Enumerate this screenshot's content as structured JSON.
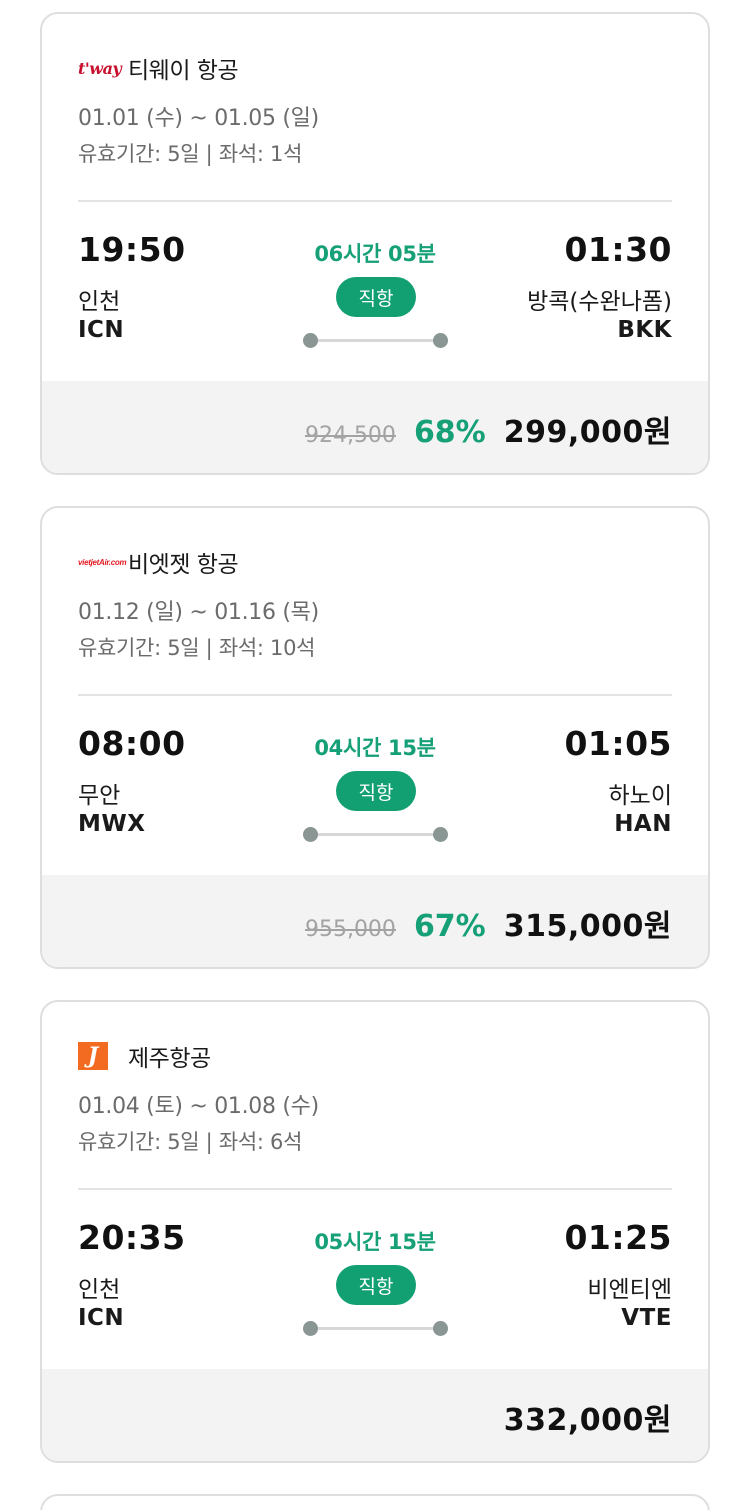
{
  "flights": [
    {
      "airline": "티웨이 항공",
      "logo_text": "t'way",
      "logo_icon": "tway-logo-icon",
      "dates": "01.01 (수) ~ 01.05 (일)",
      "meta": "유효기간: 5일 | 좌석: 1석",
      "departure": {
        "time": "19:50",
        "city": "인천",
        "code": "ICN"
      },
      "arrival": {
        "time": "01:30",
        "city": "방콕(수완나폼)",
        "code": "BKK"
      },
      "duration": "06시간 05분",
      "type_badge": "직항",
      "original_price": "924,500",
      "discount": "68%",
      "final_price": "299,000원"
    },
    {
      "airline": "비엣젯 항공",
      "logo_text": "vietjetAir.com",
      "logo_icon": "vietjet-logo-icon",
      "dates": "01.12 (일) ~ 01.16 (목)",
      "meta": "유효기간: 5일 | 좌석: 10석",
      "departure": {
        "time": "08:00",
        "city": "무안",
        "code": "MWX"
      },
      "arrival": {
        "time": "01:05",
        "city": "하노이",
        "code": "HAN"
      },
      "duration": "04시간 15분",
      "type_badge": "직항",
      "original_price": "955,000",
      "discount": "67%",
      "final_price": "315,000원"
    },
    {
      "airline": "제주항공",
      "logo_text": "J",
      "logo_icon": "jejuair-logo-icon",
      "dates": "01.04 (토) ~ 01.08 (수)",
      "meta": "유효기간: 5일 | 좌석: 6석",
      "departure": {
        "time": "20:35",
        "city": "인천",
        "code": "ICN"
      },
      "arrival": {
        "time": "01:25",
        "city": "비엔티엔",
        "code": "VTE"
      },
      "duration": "05시간 15분",
      "type_badge": "직항",
      "final_price": "332,000원"
    }
  ],
  "colors": {
    "accent_green": "#16a077",
    "badge_green": "#12a073",
    "card_border": "#dedede",
    "price_bar_bg": "#f3f3f3",
    "tway_red": "#c8102e",
    "vietjet_red": "#e31b23",
    "jeju_orange": "#f26b21"
  }
}
